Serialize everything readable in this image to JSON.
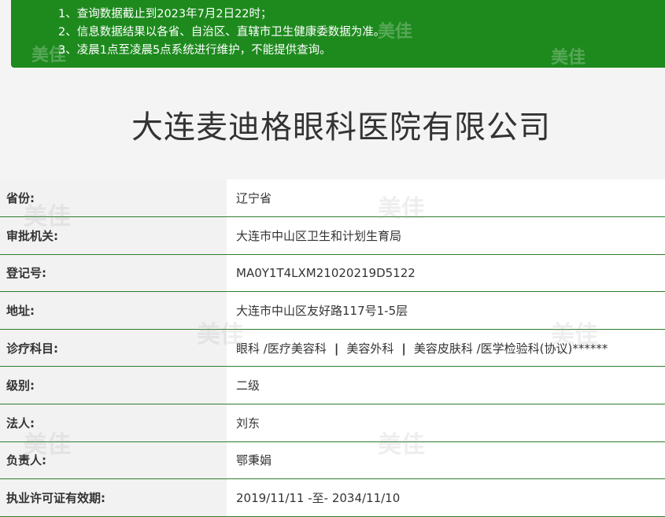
{
  "notice": {
    "lines": [
      "1、查询数据截止到2023年7月2日22时；",
      "2、信息数据结果以各省、自治区、直辖市卫生健康委数据为准。",
      "3、凌晨1点至凌晨5点系统进行维护，不能提供查询。"
    ],
    "background": "#1e8a1e"
  },
  "watermark_text": "美佳",
  "page_title": "大连麦迪格眼科医院有限公司",
  "rows": [
    {
      "label": "省份:",
      "value": "辽宁省"
    },
    {
      "label": "审批机关:",
      "value": "大连市中山区卫生和计划生育局"
    },
    {
      "label": "登记号:",
      "value": "MA0Y1T4LXM21020219D5122"
    },
    {
      "label": "地址:",
      "value": "大连市中山区友好路117号1-5层"
    },
    {
      "label": "诊疗科目:",
      "subjects": [
        "眼科 /医疗美容科",
        "美容外科",
        "美容皮肤科 /医学检验科(协议)******"
      ],
      "separator": "|"
    },
    {
      "label": "级别:",
      "value": "二级"
    },
    {
      "label": "法人:",
      "value": "刘东"
    },
    {
      "label": "负责人:",
      "value": "鄂秉娟"
    },
    {
      "label": "执业许可证有效期:",
      "value": "2019/11/11 -至- 2034/11/10"
    }
  ],
  "colors": {
    "row_border": "#2f7d2f",
    "label_bg": "#f2f2f2",
    "value_bg": "#ffffff"
  }
}
